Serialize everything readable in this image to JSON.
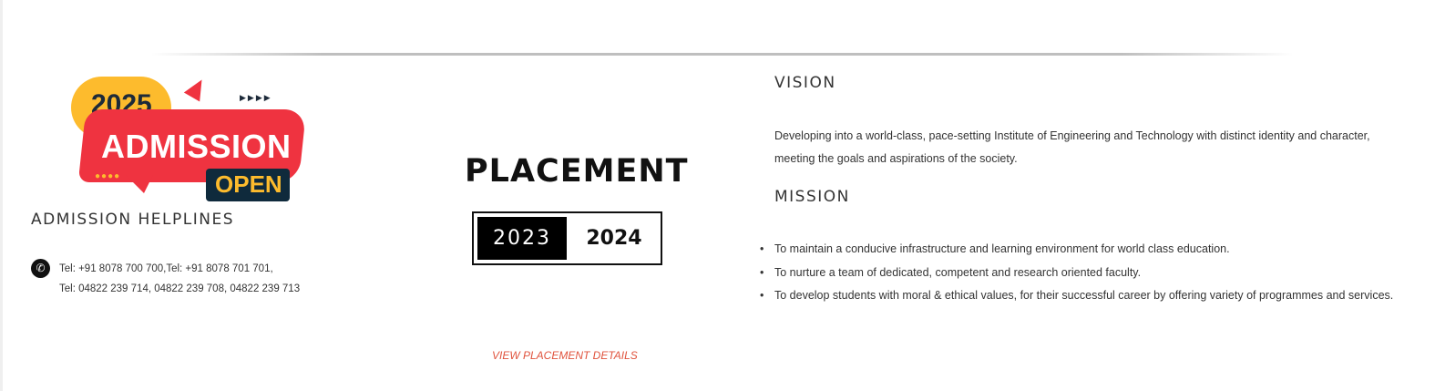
{
  "admission_badge": {
    "year": "2025",
    "main_text": "ADMISSION",
    "open_text": "OPEN"
  },
  "helplines": {
    "title": "ADMISSION HELPLINES",
    "icon": "phone-icon",
    "line1": "Tel: +91 8078 700 700,Tel: +91 8078 701 701,",
    "line2": "Tel: 04822 239 714,  04822 239 708, 04822 239 713"
  },
  "placement": {
    "title": "PLACEMENT",
    "year_from": "2023",
    "year_to": "2024",
    "link_label": "VIEW PLACEMENT DETAILS"
  },
  "vision": {
    "title": "VISION",
    "text": "Developing into a world-class, pace-setting Institute of Engineering and Technology with distinct identity and character, meeting the goals and aspirations of the society."
  },
  "mission": {
    "title": "MISSION",
    "items": [
      "To maintain a conducive infrastructure and learning environment for world class education.",
      "To nurture a team of dedicated, competent and research oriented faculty.",
      "To develop students with moral & ethical values, for their successful career by offering variety of programmes and services."
    ]
  },
  "colors": {
    "accent_red": "#ef3340",
    "accent_yellow": "#fdbb2d",
    "link": "#e0533d"
  }
}
